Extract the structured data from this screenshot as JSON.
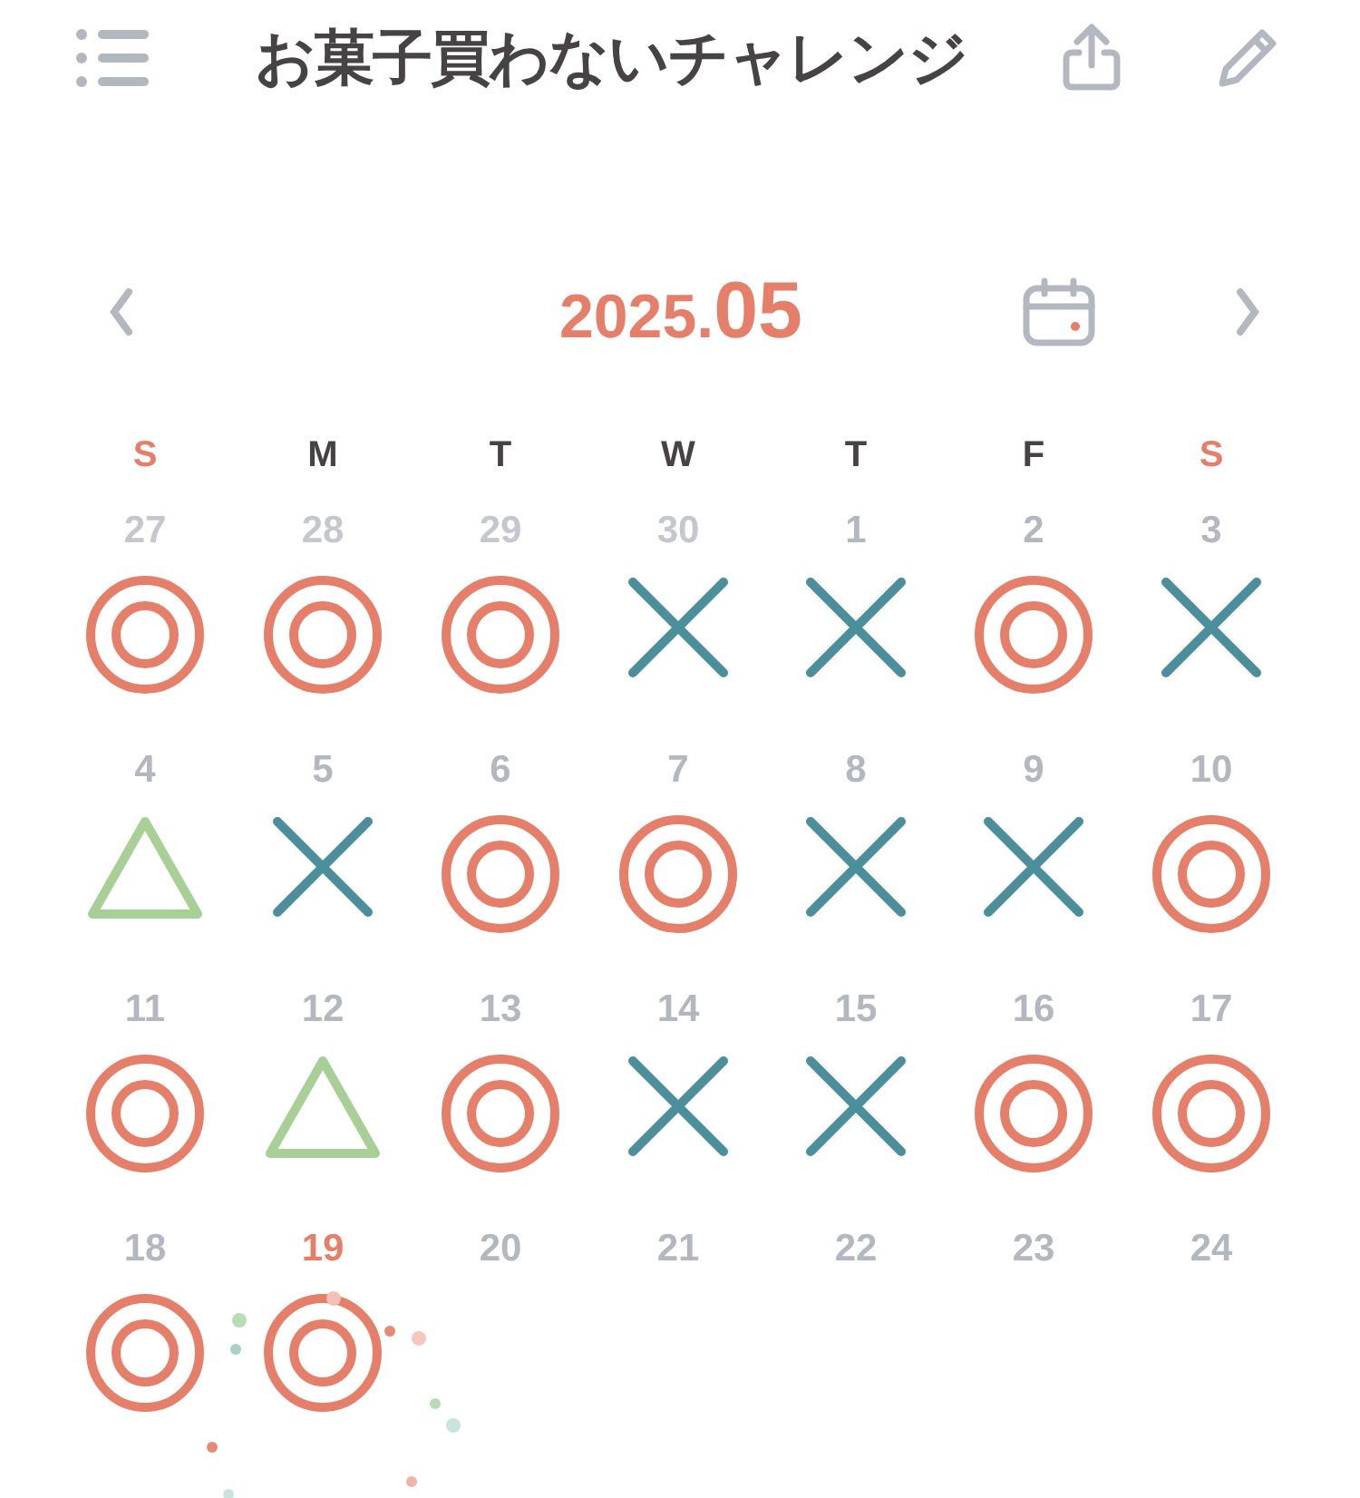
{
  "header": {
    "title": "お菓子買わないチャレンジ"
  },
  "month_nav": {
    "year": "2025.",
    "month": "05"
  },
  "weekdays": [
    {
      "label": "S",
      "weekend": true
    },
    {
      "label": "M",
      "weekend": false
    },
    {
      "label": "T",
      "weekend": false
    },
    {
      "label": "W",
      "weekend": false
    },
    {
      "label": "T",
      "weekend": false
    },
    {
      "label": "F",
      "weekend": false
    },
    {
      "label": "S",
      "weekend": true
    }
  ],
  "days": [
    {
      "date": "27",
      "other_month": true,
      "today": false,
      "kind": "circle"
    },
    {
      "date": "28",
      "other_month": true,
      "today": false,
      "kind": "circle"
    },
    {
      "date": "29",
      "other_month": true,
      "today": false,
      "kind": "circle"
    },
    {
      "date": "30",
      "other_month": true,
      "today": false,
      "kind": "cross"
    },
    {
      "date": "1",
      "other_month": false,
      "today": false,
      "kind": "cross"
    },
    {
      "date": "2",
      "other_month": false,
      "today": false,
      "kind": "circle"
    },
    {
      "date": "3",
      "other_month": false,
      "today": false,
      "kind": "cross"
    },
    {
      "date": "4",
      "other_month": false,
      "today": false,
      "kind": "triangle"
    },
    {
      "date": "5",
      "other_month": false,
      "today": false,
      "kind": "cross"
    },
    {
      "date": "6",
      "other_month": false,
      "today": false,
      "kind": "circle"
    },
    {
      "date": "7",
      "other_month": false,
      "today": false,
      "kind": "circle"
    },
    {
      "date": "8",
      "other_month": false,
      "today": false,
      "kind": "cross"
    },
    {
      "date": "9",
      "other_month": false,
      "today": false,
      "kind": "cross"
    },
    {
      "date": "10",
      "other_month": false,
      "today": false,
      "kind": "circle"
    },
    {
      "date": "11",
      "other_month": false,
      "today": false,
      "kind": "circle"
    },
    {
      "date": "12",
      "other_month": false,
      "today": false,
      "kind": "triangle"
    },
    {
      "date": "13",
      "other_month": false,
      "today": false,
      "kind": "circle"
    },
    {
      "date": "14",
      "other_month": false,
      "today": false,
      "kind": "cross"
    },
    {
      "date": "15",
      "other_month": false,
      "today": false,
      "kind": "cross"
    },
    {
      "date": "16",
      "other_month": false,
      "today": false,
      "kind": "circle"
    },
    {
      "date": "17",
      "other_month": false,
      "today": false,
      "kind": "circle"
    },
    {
      "date": "18",
      "other_month": false,
      "today": false,
      "kind": "circle"
    },
    {
      "date": "19",
      "other_month": false,
      "today": true,
      "kind": "circle"
    },
    {
      "date": "20",
      "other_month": false,
      "today": false
    },
    {
      "date": "21",
      "other_month": false,
      "today": false
    },
    {
      "date": "22",
      "other_month": false,
      "today": false
    },
    {
      "date": "23",
      "other_month": false,
      "today": false
    },
    {
      "date": "24",
      "other_month": false,
      "today": false
    }
  ]
}
